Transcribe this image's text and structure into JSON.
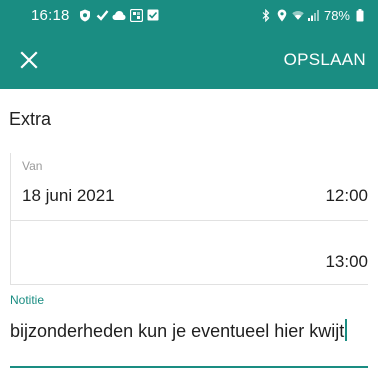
{
  "status_bar": {
    "time": "16:18",
    "battery": "78%",
    "left_icons": [
      "shield-icon",
      "check-icon",
      "cloud-icon",
      "app-icon",
      "checkbox-icon"
    ],
    "right_icons": [
      "bluetooth-icon",
      "location-icon",
      "wifi-icon",
      "signal-icon",
      "battery-icon"
    ]
  },
  "app_bar": {
    "close_icon": "close-icon",
    "save_label": "OPSLAAN"
  },
  "form": {
    "section_title": "Extra",
    "from": {
      "label": "Van",
      "date": "18 juni 2021",
      "time": "12:00"
    },
    "to": {
      "date": "",
      "time": "13:00"
    },
    "note": {
      "label": "Notitie",
      "value": "bijzonderheden kun je eventueel hier kwijt"
    }
  },
  "colors": {
    "accent": "#1a8d82",
    "text": "#1f1f1f",
    "label": "#9a9a9a",
    "divider": "#e1e1e1"
  }
}
